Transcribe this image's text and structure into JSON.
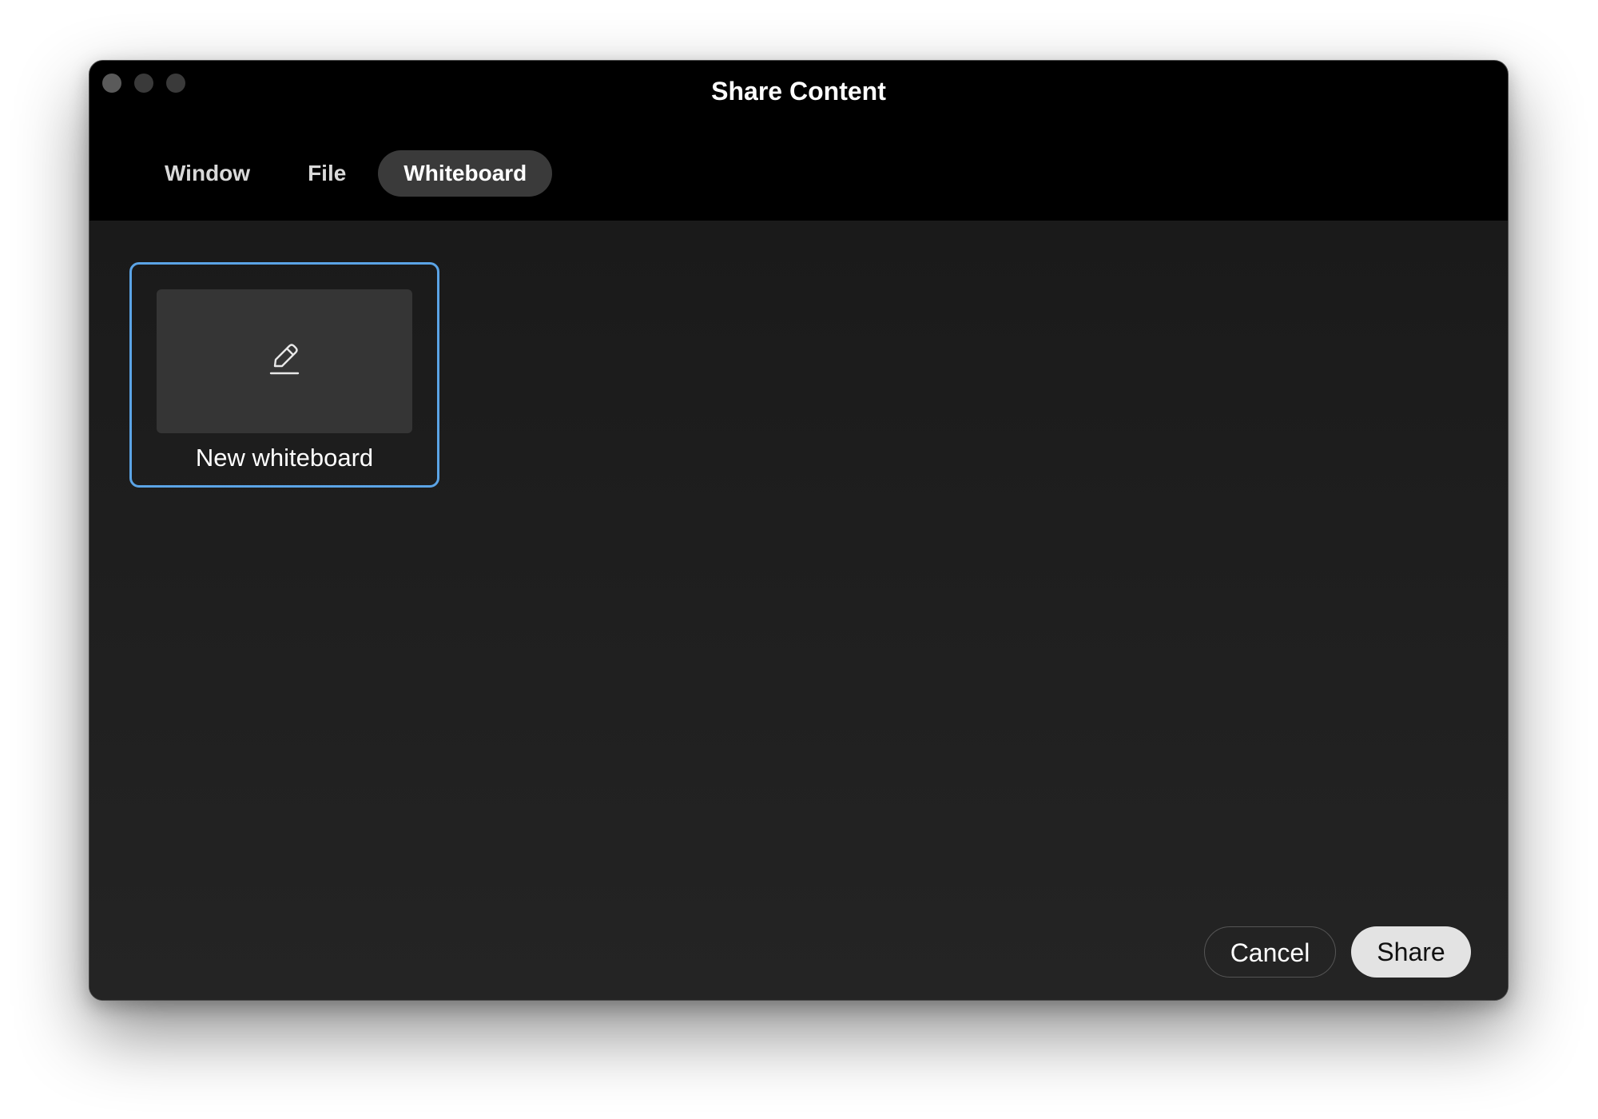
{
  "window": {
    "title": "Share Content"
  },
  "tabs": [
    {
      "label": "Window",
      "active": false
    },
    {
      "label": "File",
      "active": false
    },
    {
      "label": "Whiteboard",
      "active": true
    }
  ],
  "whiteboard": {
    "new_label": "New whiteboard",
    "icon": "pencil-icon",
    "selected": true
  },
  "footer": {
    "cancel_label": "Cancel",
    "share_label": "Share"
  },
  "colors": {
    "selection_border": "#5ba4e6",
    "window_bg": "#000000",
    "content_bg": "#1f1f1f",
    "active_tab_bg": "#3a3a3a",
    "share_button_bg": "#e3e3e3"
  }
}
